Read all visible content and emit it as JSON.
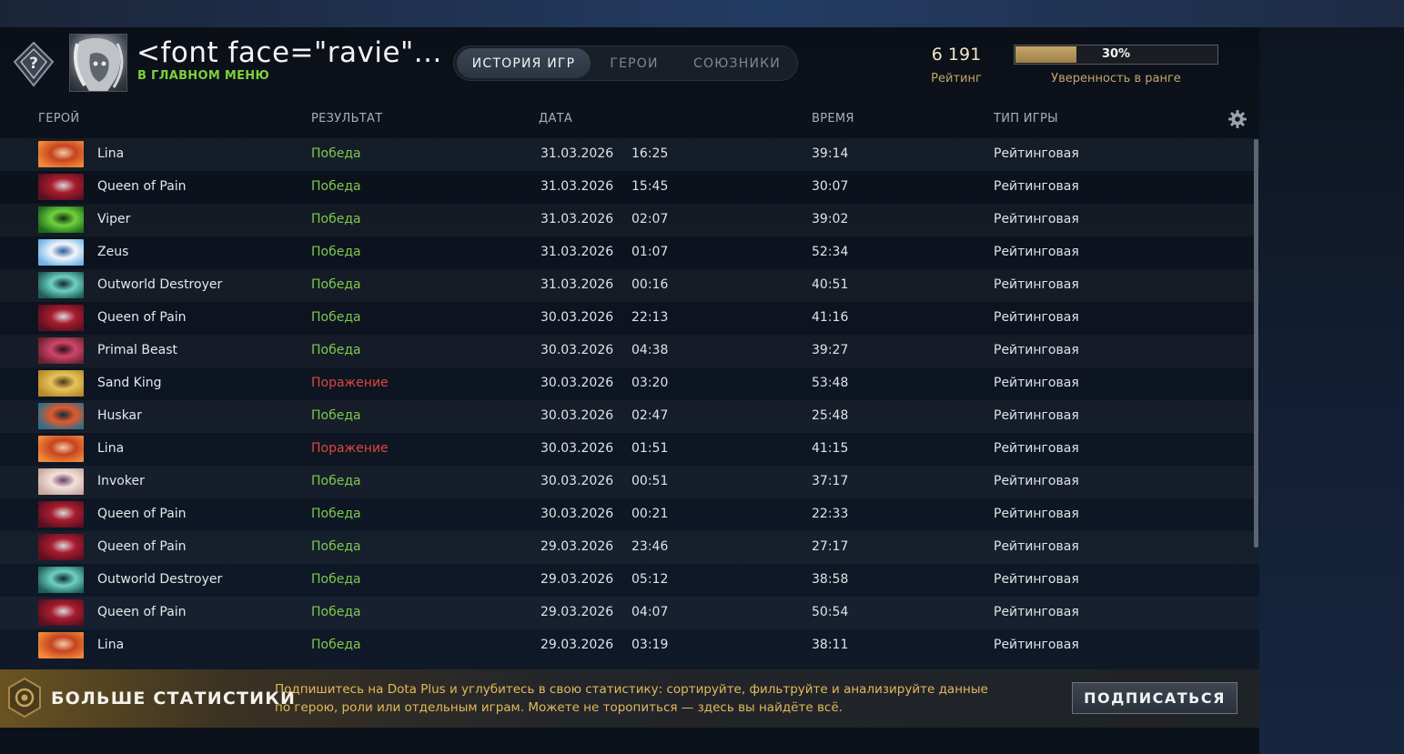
{
  "player": {
    "name": "<font face=\"ravie\"...",
    "status": "В ГЛАВНОМ МЕНЮ"
  },
  "tabs": [
    {
      "label": "ИСТОРИЯ ИГР",
      "active": true
    },
    {
      "label": "ГЕРОИ",
      "active": false
    },
    {
      "label": "СОЮЗНИКИ",
      "active": false
    }
  ],
  "rating": {
    "value": "6 191",
    "label": "Рейтинг"
  },
  "confidence": {
    "percent": 30,
    "text": "30%",
    "label": "Уверенность в ранге"
  },
  "columns": {
    "hero": "ГЕРОЙ",
    "result": "РЕЗУЛЬТАТ",
    "date": "ДАТА",
    "duration": "ВРЕМЯ",
    "gametype": "ТИП ИГРЫ"
  },
  "matches": [
    {
      "hero": "Lina",
      "icon": "lina",
      "result": "Победа",
      "win": true,
      "date": "31.03.2026",
      "time": "16:25",
      "duration": "39:14",
      "type": "Рейтинговая"
    },
    {
      "hero": "Queen of Pain",
      "icon": "qop",
      "result": "Победа",
      "win": true,
      "date": "31.03.2026",
      "time": "15:45",
      "duration": "30:07",
      "type": "Рейтинговая"
    },
    {
      "hero": "Viper",
      "icon": "viper",
      "result": "Победа",
      "win": true,
      "date": "31.03.2026",
      "time": "02:07",
      "duration": "39:02",
      "type": "Рейтинговая"
    },
    {
      "hero": "Zeus",
      "icon": "zeus",
      "result": "Победа",
      "win": true,
      "date": "31.03.2026",
      "time": "01:07",
      "duration": "52:34",
      "type": "Рейтинговая"
    },
    {
      "hero": "Outworld Destroyer",
      "icon": "od",
      "result": "Победа",
      "win": true,
      "date": "31.03.2026",
      "time": "00:16",
      "duration": "40:51",
      "type": "Рейтинговая"
    },
    {
      "hero": "Queen of Pain",
      "icon": "qop",
      "result": "Победа",
      "win": true,
      "date": "30.03.2026",
      "time": "22:13",
      "duration": "41:16",
      "type": "Рейтинговая"
    },
    {
      "hero": "Primal Beast",
      "icon": "primal",
      "result": "Победа",
      "win": true,
      "date": "30.03.2026",
      "time": "04:38",
      "duration": "39:27",
      "type": "Рейтинговая"
    },
    {
      "hero": "Sand King",
      "icon": "sandking",
      "result": "Поражение",
      "win": false,
      "date": "30.03.2026",
      "time": "03:20",
      "duration": "53:48",
      "type": "Рейтинговая"
    },
    {
      "hero": "Huskar",
      "icon": "huskar",
      "result": "Победа",
      "win": true,
      "date": "30.03.2026",
      "time": "02:47",
      "duration": "25:48",
      "type": "Рейтинговая"
    },
    {
      "hero": "Lina",
      "icon": "lina",
      "result": "Поражение",
      "win": false,
      "date": "30.03.2026",
      "time": "01:51",
      "duration": "41:15",
      "type": "Рейтинговая"
    },
    {
      "hero": "Invoker",
      "icon": "invoker",
      "result": "Победа",
      "win": true,
      "date": "30.03.2026",
      "time": "00:51",
      "duration": "37:17",
      "type": "Рейтинговая"
    },
    {
      "hero": "Queen of Pain",
      "icon": "qop",
      "result": "Победа",
      "win": true,
      "date": "30.03.2026",
      "time": "00:21",
      "duration": "22:33",
      "type": "Рейтинговая"
    },
    {
      "hero": "Queen of Pain",
      "icon": "qop",
      "result": "Победа",
      "win": true,
      "date": "29.03.2026",
      "time": "23:46",
      "duration": "27:17",
      "type": "Рейтинговая"
    },
    {
      "hero": "Outworld Destroyer",
      "icon": "od",
      "result": "Победа",
      "win": true,
      "date": "29.03.2026",
      "time": "05:12",
      "duration": "38:58",
      "type": "Рейтинговая"
    },
    {
      "hero": "Queen of Pain",
      "icon": "qop",
      "result": "Победа",
      "win": true,
      "date": "29.03.2026",
      "time": "04:07",
      "duration": "50:54",
      "type": "Рейтинговая"
    },
    {
      "hero": "Lina",
      "icon": "lina",
      "result": "Победа",
      "win": true,
      "date": "29.03.2026",
      "time": "03:19",
      "duration": "38:11",
      "type": "Рейтинговая"
    }
  ],
  "hero_colors": {
    "lina": [
      "#f08a3a",
      "#c7431f",
      "#f3c9a4"
    ],
    "qop": [
      "#5a1020",
      "#a81c2e",
      "#d9d9dc"
    ],
    "viper": [
      "#1f6a1c",
      "#6fd13d",
      "#0f3010"
    ],
    "zeus": [
      "#6fb3e8",
      "#f2f6fb",
      "#2d5d9c"
    ],
    "od": [
      "#1f5e57",
      "#6ed0c4",
      "#0d2a2a"
    ],
    "primal": [
      "#6a2231",
      "#d0466b",
      "#2d0f1a"
    ],
    "sandking": [
      "#b58a2b",
      "#e9c35a",
      "#4a3a15"
    ],
    "huskar": [
      "#2f6f8a",
      "#e15a2d",
      "#152b3a"
    ],
    "invoker": [
      "#c9a7a1",
      "#f1e2da",
      "#6b3b63"
    ]
  },
  "promo": {
    "title": "БОЛЬШЕ СТАТИСТИКИ",
    "text": "Подпишитесь на Dota Plus и углубитесь в свою статистику: сортируйте, фильтруйте и анализируйте данные по герою, роли или отдельным играм. Можете не торопиться — здесь вы найдёте всё.",
    "button": "ПОДПИСАТЬСЯ"
  },
  "colors": {
    "win": "#7fc94d",
    "loss": "#e0463a",
    "gold": "#c5a66a",
    "status_green": "#7bd03d"
  }
}
